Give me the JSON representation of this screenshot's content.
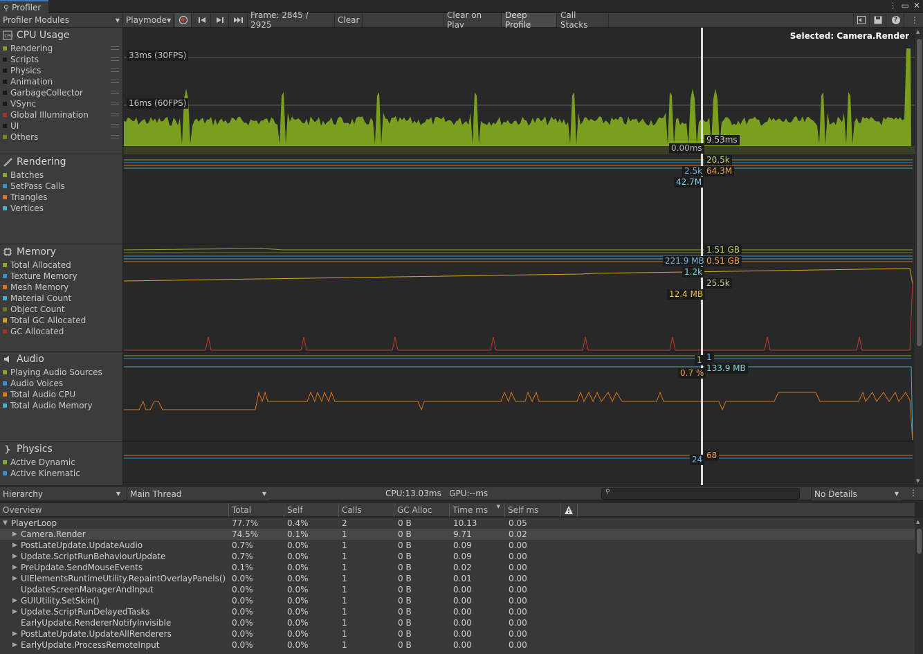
{
  "window": {
    "tab_title": "Profiler"
  },
  "toolbar": {
    "modules_dropdown": "Profiler Modules",
    "mode_dropdown": "Playmode",
    "frame_label": "Frame: 2845 / 2925",
    "clear": "Clear",
    "clear_on_play": "Clear on Play",
    "deep_profile": "Deep Profile",
    "call_stacks": "Call Stacks"
  },
  "modules": [
    {
      "title": "CPU Usage",
      "icon": "cpu-icon",
      "legend": [
        {
          "label": "Rendering",
          "color": "#78a12b"
        },
        {
          "label": "Scripts",
          "color": "#1a1a1a"
        },
        {
          "label": "Physics",
          "color": "#1a1a1a"
        },
        {
          "label": "Animation",
          "color": "#1a1a1a"
        },
        {
          "label": "GarbageCollector",
          "color": "#1a1a1a"
        },
        {
          "label": "VSync",
          "color": "#1a1a1a"
        },
        {
          "label": "Global Illumination",
          "color": "#a3312a"
        },
        {
          "label": "UI",
          "color": "#1a1a1a"
        },
        {
          "label": "Others",
          "color": "#6a8a27"
        }
      ]
    },
    {
      "title": "Rendering",
      "icon": "brush-icon",
      "legend": [
        {
          "label": "Batches",
          "color": "#84a72c"
        },
        {
          "label": "SetPass Calls",
          "color": "#3a8fc7"
        },
        {
          "label": "Triangles",
          "color": "#d9751a"
        },
        {
          "label": "Vertices",
          "color": "#44b0c9"
        }
      ]
    },
    {
      "title": "Memory",
      "icon": "chip-icon",
      "legend": [
        {
          "label": "Total Allocated",
          "color": "#84a72c"
        },
        {
          "label": "Texture Memory",
          "color": "#3a8fc7"
        },
        {
          "label": "Mesh Memory",
          "color": "#d9751a"
        },
        {
          "label": "Material Count",
          "color": "#44b0c9"
        },
        {
          "label": "Object Count",
          "color": "#6a7a22"
        },
        {
          "label": "Total GC Allocated",
          "color": "#d9a61a"
        },
        {
          "label": "GC Allocated",
          "color": "#a3312a"
        }
      ]
    },
    {
      "title": "Audio",
      "icon": "speaker-icon",
      "legend": [
        {
          "label": "Playing Audio Sources",
          "color": "#84a72c"
        },
        {
          "label": "Audio Voices",
          "color": "#3a8fc7"
        },
        {
          "label": "Total Audio CPU",
          "color": "#d9751a"
        },
        {
          "label": "Total Audio Memory",
          "color": "#44b0c9"
        }
      ]
    },
    {
      "title": "Physics",
      "icon": "physics-icon",
      "legend": [
        {
          "label": "Active Dynamic",
          "color": "#84a72c"
        },
        {
          "label": "Active Kinematic",
          "color": "#3a8fc7"
        }
      ]
    }
  ],
  "charts": {
    "selected": "Selected: Camera.Render",
    "cpu_33": "33ms (30FPS)",
    "cpu_16": "16ms (60FPS)",
    "cpu_val1": "9.53ms",
    "cpu_val2": "0.00ms",
    "rend_batches": "20.5k",
    "rend_setpass": "2.5k",
    "rend_tris": "64.3M",
    "rend_verts": "42.7M",
    "mem_total": "1.51 GB",
    "mem_texture": "221.9 MB",
    "mem_mesh": "0.51 GB",
    "mem_material": "1.2k",
    "mem_object": "25.5k",
    "mem_gc": "12.4 MB",
    "audio_sources": "1",
    "audio_voices": "1",
    "audio_cpu": "0.7 %",
    "audio_mem": "133.9 MB",
    "phys_dynamic": "68",
    "phys_kinematic": "24"
  },
  "bottom_toolbar": {
    "view": "Hierarchy",
    "thread": "Main Thread",
    "cpu_gpu": "CPU:13.03ms   GPU:--ms",
    "details": "No Details"
  },
  "table": {
    "headers": [
      "Overview",
      "Total",
      "Self",
      "Calls",
      "GC Alloc",
      "Time ms",
      "Self ms"
    ],
    "rows": [
      {
        "name": "PlayerLoop",
        "expander": "down",
        "indent": 0,
        "total": "77.7%",
        "self": "0.4%",
        "calls": "2",
        "gc": "0 B",
        "time": "10.13",
        "selfms": "0.05"
      },
      {
        "name": "Camera.Render",
        "expander": "right",
        "indent": 1,
        "total": "74.5%",
        "self": "0.1%",
        "calls": "1",
        "gc": "0 B",
        "time": "9.71",
        "selfms": "0.02",
        "selected": true
      },
      {
        "name": "PostLateUpdate.UpdateAudio",
        "expander": "right",
        "indent": 1,
        "total": "0.7%",
        "self": "0.0%",
        "calls": "1",
        "gc": "0 B",
        "time": "0.09",
        "selfms": "0.00"
      },
      {
        "name": "Update.ScriptRunBehaviourUpdate",
        "expander": "right",
        "indent": 1,
        "total": "0.7%",
        "self": "0.0%",
        "calls": "1",
        "gc": "0 B",
        "time": "0.09",
        "selfms": "0.00"
      },
      {
        "name": "PreUpdate.SendMouseEvents",
        "expander": "right",
        "indent": 1,
        "total": "0.1%",
        "self": "0.0%",
        "calls": "1",
        "gc": "0 B",
        "time": "0.02",
        "selfms": "0.00"
      },
      {
        "name": "UIElementsRuntimeUtility.RepaintOverlayPanels()",
        "expander": "right",
        "indent": 1,
        "total": "0.0%",
        "self": "0.0%",
        "calls": "1",
        "gc": "0 B",
        "time": "0.01",
        "selfms": "0.00"
      },
      {
        "name": "UpdateScreenManagerAndInput",
        "expander": "",
        "indent": 1,
        "total": "0.0%",
        "self": "0.0%",
        "calls": "1",
        "gc": "0 B",
        "time": "0.00",
        "selfms": "0.00"
      },
      {
        "name": "GUIUtility.SetSkin()",
        "expander": "right",
        "indent": 1,
        "total": "0.0%",
        "self": "0.0%",
        "calls": "1",
        "gc": "0 B",
        "time": "0.00",
        "selfms": "0.00"
      },
      {
        "name": "Update.ScriptRunDelayedTasks",
        "expander": "right",
        "indent": 1,
        "total": "0.0%",
        "self": "0.0%",
        "calls": "1",
        "gc": "0 B",
        "time": "0.00",
        "selfms": "0.00"
      },
      {
        "name": "EarlyUpdate.RendererNotifyInvisible",
        "expander": "",
        "indent": 1,
        "total": "0.0%",
        "self": "0.0%",
        "calls": "1",
        "gc": "0 B",
        "time": "0.00",
        "selfms": "0.00"
      },
      {
        "name": "PostLateUpdate.UpdateAllRenderers",
        "expander": "right",
        "indent": 1,
        "total": "0.0%",
        "self": "0.0%",
        "calls": "1",
        "gc": "0 B",
        "time": "0.00",
        "selfms": "0.00"
      },
      {
        "name": "EarlyUpdate.ProcessRemoteInput",
        "expander": "right",
        "indent": 1,
        "total": "0.0%",
        "self": "0.0%",
        "calls": "1",
        "gc": "0 B",
        "time": "0.00",
        "selfms": "0.00"
      }
    ]
  }
}
